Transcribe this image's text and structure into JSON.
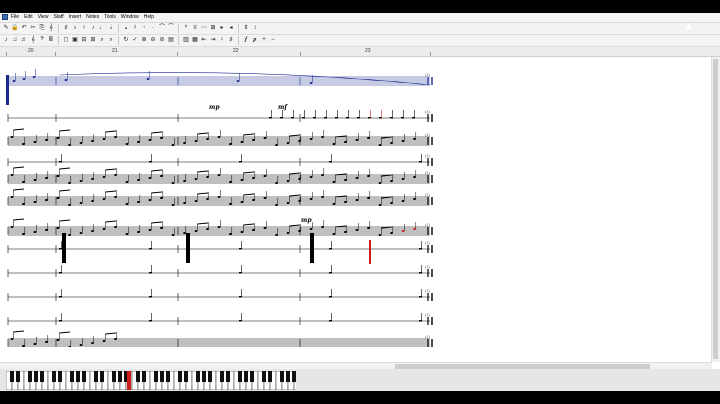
{
  "menu": {
    "items": [
      "File",
      "Edit",
      "View",
      "Staff",
      "Insert",
      "Notes",
      "Tools",
      "Window",
      "Help"
    ]
  },
  "toolbar1": {
    "buttons": [
      "✎",
      "🔒",
      "↶",
      "✂",
      "⎘",
      "𝄞",
      "♯",
      "♭",
      "♮",
      "♪",
      "♩",
      "𝅗𝅥",
      "𝅝",
      "𝄽",
      "𝄾",
      "·",
      "⌒",
      "⁀",
      "ᵗʳ",
      "≡",
      "⋯",
      "⊞",
      "▸",
      "◂",
      "⇕",
      "↕"
    ]
  },
  "toolbar2": {
    "buttons": [
      "♪",
      "♫",
      "♬",
      "𝄞",
      "𝄢",
      "𝄡",
      "◻",
      "▣",
      "⊟",
      "⊞",
      "⌕",
      "⌕",
      "↻",
      "✓",
      "⊕",
      "⊖",
      "⊘",
      "▤",
      "▥",
      "▦",
      "⇤",
      "⇥",
      "♮",
      "♯",
      "𝆑",
      "𝆏",
      "+",
      "−"
    ]
  },
  "ruler": {
    "labels": [
      "20",
      "21",
      "22",
      "23"
    ]
  },
  "score": {
    "dynamics": [
      "mp",
      "mf",
      "mp"
    ]
  },
  "colors": {
    "selected_staff": "#1a2a8f",
    "highlight_note": "#cc1b1b",
    "background": "#ffffff"
  },
  "keyboard": {
    "octaves": 7
  }
}
